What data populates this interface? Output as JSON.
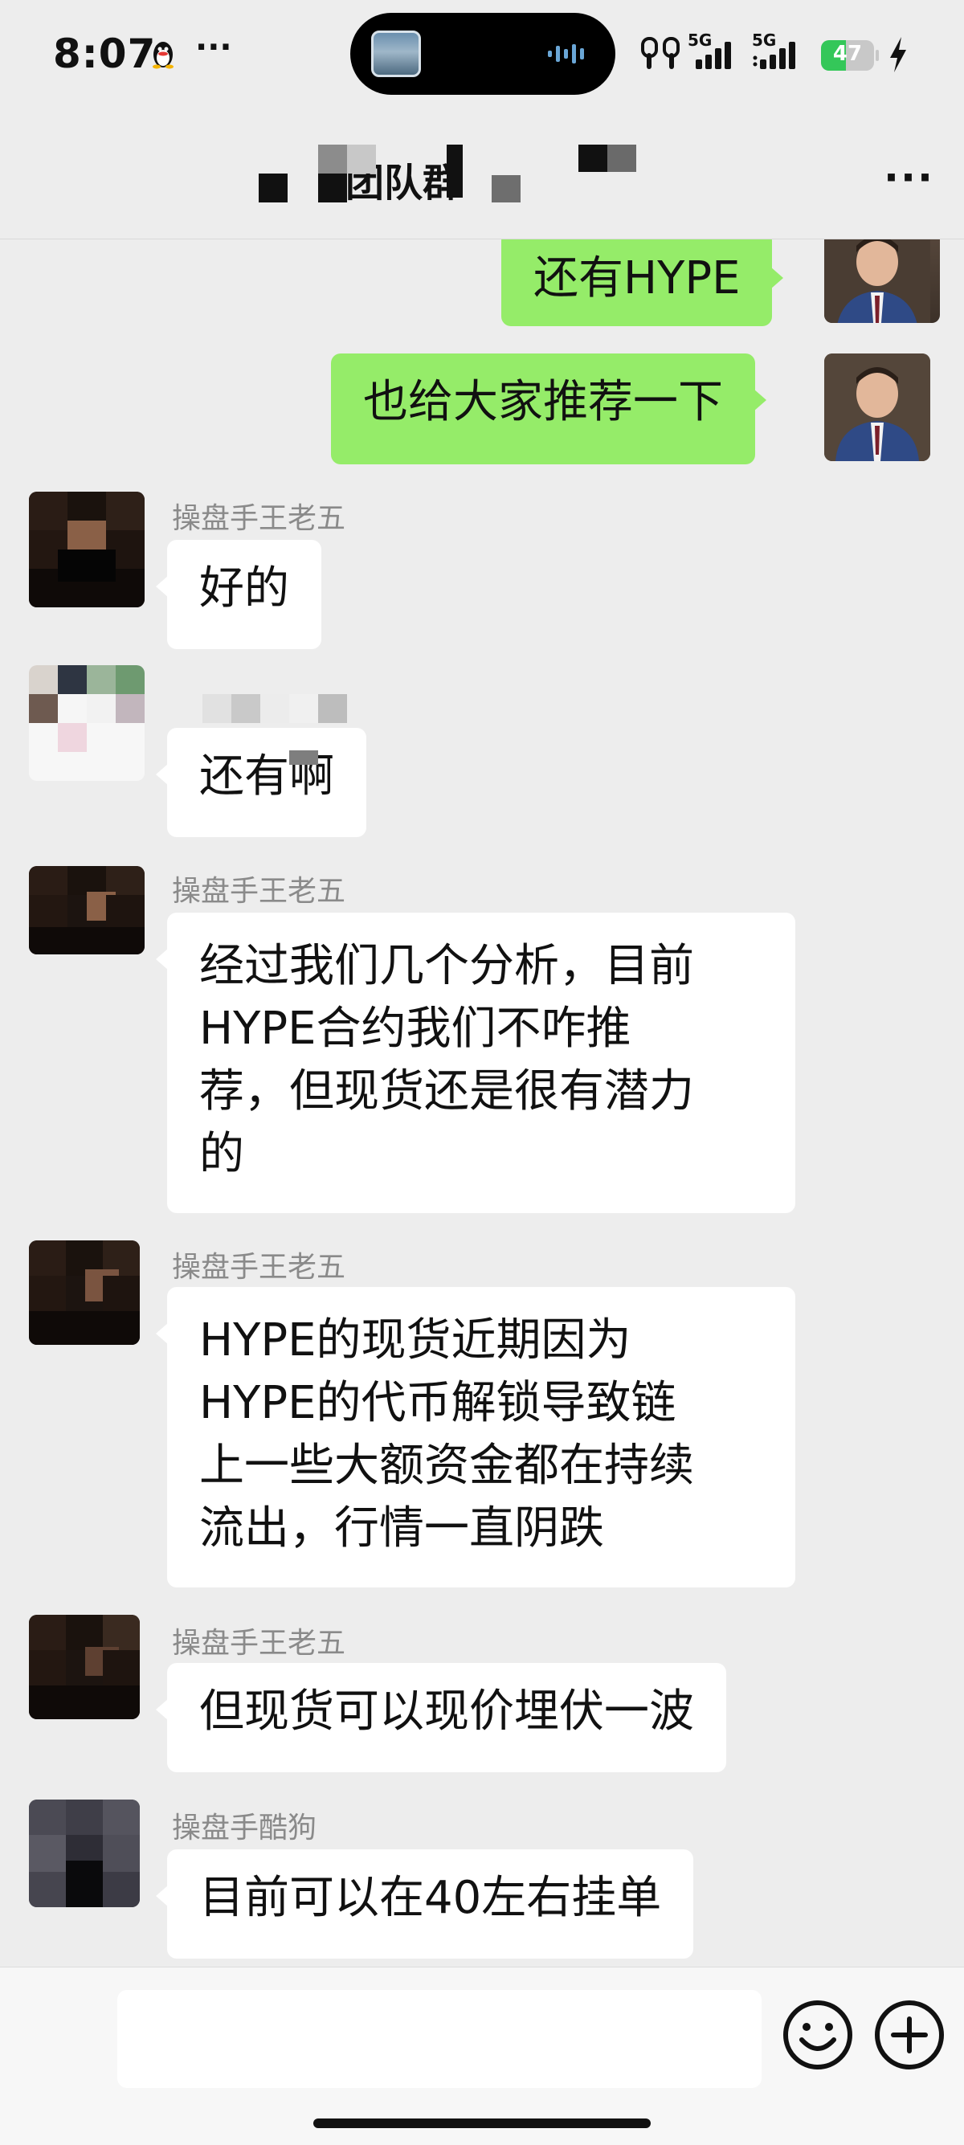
{
  "status_bar": {
    "time": "8:07",
    "more": "···",
    "signal_1": "5G",
    "signal_2": "5G",
    "battery_level": "47",
    "battery_fraction": 0.47,
    "battery_color": "#34c759"
  },
  "nav": {
    "title": "团队群",
    "more": "···"
  },
  "messages": [
    {
      "side": "out",
      "text": "还有HYPE"
    },
    {
      "side": "out",
      "text": "也给大家推荐一下"
    },
    {
      "side": "in",
      "sender": "操盘手王老五",
      "text": "好的"
    },
    {
      "side": "in",
      "sender": "",
      "text": "还有啊"
    },
    {
      "side": "in",
      "sender": "操盘手王老五",
      "lines": [
        "经过我们几个分析，目前",
        "HYPE合约我们不咋推",
        "荐，但现货还是很有潜力",
        "的"
      ]
    },
    {
      "side": "in",
      "sender": "操盘手王老五",
      "lines": [
        "HYPE的现货近期因为",
        "HYPE的代币解锁导致链",
        "上一些大额资金都在持续",
        "流出，行情一直阴跌"
      ]
    },
    {
      "side": "in",
      "sender": "操盘手王老五",
      "text": "但现货可以现价埋伏一波"
    },
    {
      "side": "in",
      "sender": "操盘手酷狗",
      "text": "目前可以在40左右挂单"
    }
  ],
  "input": {
    "placeholder": "",
    "emoji_icon": "smiley-face-icon",
    "plus_icon": "plus-circle-icon"
  },
  "colors": {
    "background": "#ededed",
    "outgoing_bubble": "#95ec69",
    "incoming_bubble": "#ffffff",
    "sender_name": "#8a8a8a"
  }
}
